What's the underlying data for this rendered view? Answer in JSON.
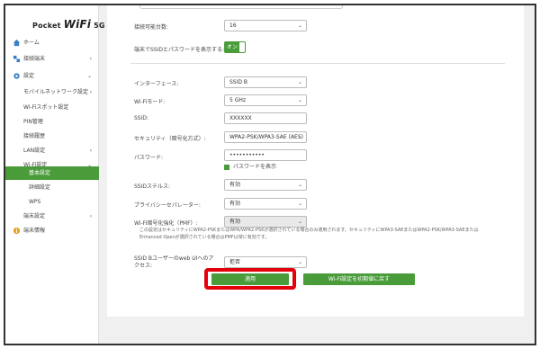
{
  "logo": {
    "prefix": "Pocket ",
    "brand": "WiFi",
    "suffix": " 5G"
  },
  "sidebar": {
    "items": [
      {
        "label": "ホーム",
        "icon": "home-icon",
        "chevron": ""
      },
      {
        "label": "接続端末",
        "icon": "devices-icon",
        "chevron": "‹"
      },
      {
        "label": "設定",
        "icon": "settings-icon",
        "chevron": "⌄"
      },
      {
        "label": "モバイルネットワーク設定",
        "chevron": "‹"
      },
      {
        "label": "Wi-Fiスポット設定",
        "chevron": ""
      },
      {
        "label": "PIN管理",
        "chevron": ""
      },
      {
        "label": "接続履歴",
        "chevron": ""
      },
      {
        "label": "LAN設定",
        "chevron": "‹"
      },
      {
        "label": "Wi-Fi設定",
        "chevron": "⌄"
      },
      {
        "label": "基本設定",
        "chevron": ""
      },
      {
        "label": "詳細設定",
        "chevron": ""
      },
      {
        "label": "WPS",
        "chevron": ""
      },
      {
        "label": "端末設定",
        "chevron": "‹"
      },
      {
        "label": "端末情報",
        "icon": "info-icon",
        "chevron": ""
      }
    ]
  },
  "form": {
    "max_connections": {
      "label": "接続可能台数:",
      "value": "16"
    },
    "show_ssid_password": {
      "label": "端末でSSIDとパスワードを表示する:",
      "toggle": "オン"
    },
    "interface": {
      "label": "インターフェース:",
      "value": "SSID B"
    },
    "wifi_mode": {
      "label": "Wi-Fiモード:",
      "value": "5 GHz"
    },
    "ssid": {
      "label": "SSID:",
      "value": "XXXXXX"
    },
    "security": {
      "label": "セキュリティ（暗号化方式）:",
      "value": "WPA2-PSK/WPA3-SAE (AES)"
    },
    "password": {
      "label": "パスワード:",
      "value": "•••••••••••",
      "show_label": "パスワードを表示"
    },
    "ssid_stealth": {
      "label": "SSIDステルス:",
      "value": "有効"
    },
    "privacy_separator": {
      "label": "プライバシーセパレーター:",
      "value": "有効"
    },
    "pmf": {
      "label": "Wi-Fi暗号化強化（PMF）:",
      "value": "有効"
    },
    "note": "この設定はセキュリティにWPA2-PSKまたはWPA/WPA2-PSKが選択されている場合のみ適用されます。セキュリティにWPA3-SAEまたはWPA2-PSK/WPA3-SAEまたはEnhanced Openが選択されている場合はPMFは常に有効です。",
    "webui_access": {
      "label": "SSID Bユーザーのweb UIへのアクセス:",
      "value": "拒否"
    }
  },
  "buttons": {
    "apply": "適用",
    "reset": "Wi-Fi設定を初期値に戻す"
  },
  "colors": {
    "accent": "#4a9c3b",
    "highlight": "#e3000b"
  }
}
